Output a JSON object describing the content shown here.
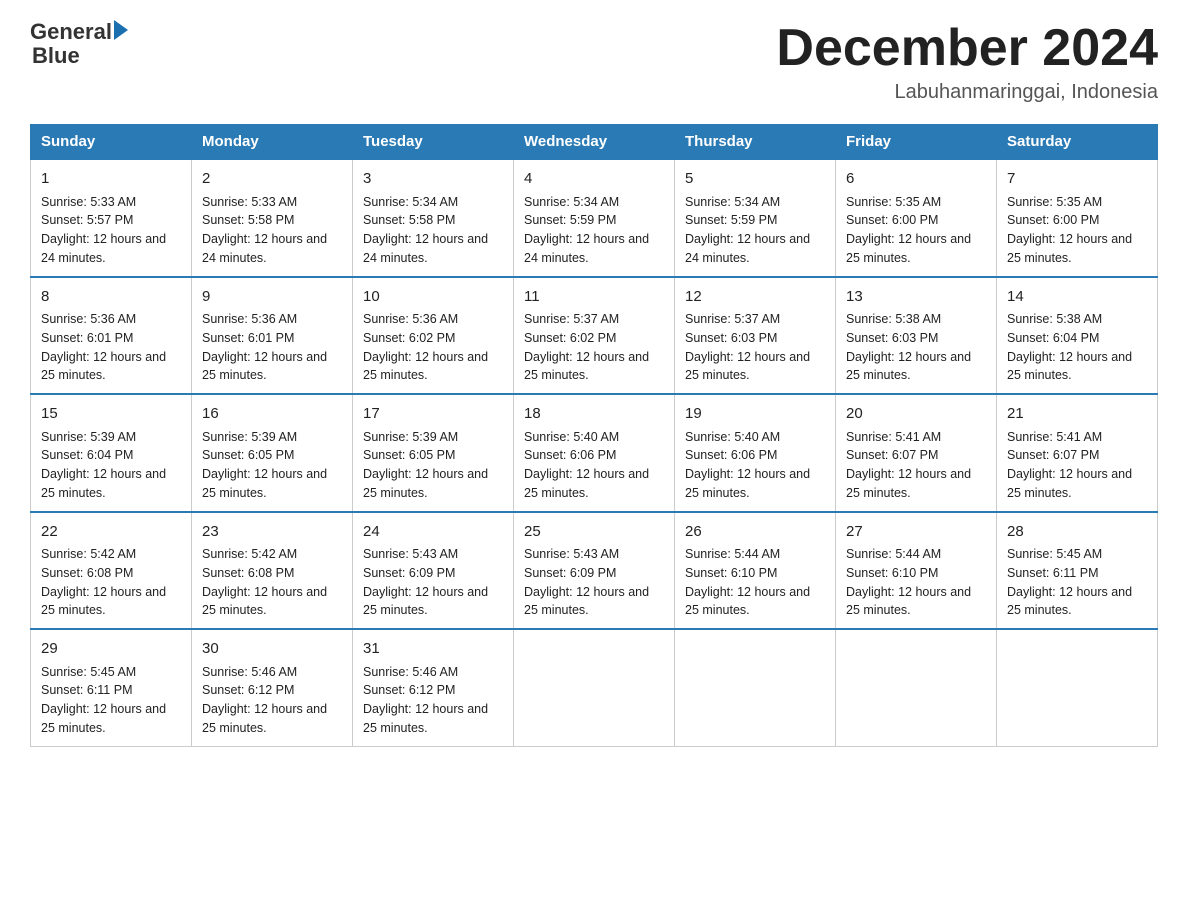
{
  "logo": {
    "line1": "General",
    "line2": "Blue"
  },
  "title": "December 2024",
  "location": "Labuhanmaringgai, Indonesia",
  "days_of_week": [
    "Sunday",
    "Monday",
    "Tuesday",
    "Wednesday",
    "Thursday",
    "Friday",
    "Saturday"
  ],
  "weeks": [
    [
      {
        "day": "1",
        "sunrise": "5:33 AM",
        "sunset": "5:57 PM",
        "daylight": "12 hours and 24 minutes."
      },
      {
        "day": "2",
        "sunrise": "5:33 AM",
        "sunset": "5:58 PM",
        "daylight": "12 hours and 24 minutes."
      },
      {
        "day": "3",
        "sunrise": "5:34 AM",
        "sunset": "5:58 PM",
        "daylight": "12 hours and 24 minutes."
      },
      {
        "day": "4",
        "sunrise": "5:34 AM",
        "sunset": "5:59 PM",
        "daylight": "12 hours and 24 minutes."
      },
      {
        "day": "5",
        "sunrise": "5:34 AM",
        "sunset": "5:59 PM",
        "daylight": "12 hours and 24 minutes."
      },
      {
        "day": "6",
        "sunrise": "5:35 AM",
        "sunset": "6:00 PM",
        "daylight": "12 hours and 25 minutes."
      },
      {
        "day": "7",
        "sunrise": "5:35 AM",
        "sunset": "6:00 PM",
        "daylight": "12 hours and 25 minutes."
      }
    ],
    [
      {
        "day": "8",
        "sunrise": "5:36 AM",
        "sunset": "6:01 PM",
        "daylight": "12 hours and 25 minutes."
      },
      {
        "day": "9",
        "sunrise": "5:36 AM",
        "sunset": "6:01 PM",
        "daylight": "12 hours and 25 minutes."
      },
      {
        "day": "10",
        "sunrise": "5:36 AM",
        "sunset": "6:02 PM",
        "daylight": "12 hours and 25 minutes."
      },
      {
        "day": "11",
        "sunrise": "5:37 AM",
        "sunset": "6:02 PM",
        "daylight": "12 hours and 25 minutes."
      },
      {
        "day": "12",
        "sunrise": "5:37 AM",
        "sunset": "6:03 PM",
        "daylight": "12 hours and 25 minutes."
      },
      {
        "day": "13",
        "sunrise": "5:38 AM",
        "sunset": "6:03 PM",
        "daylight": "12 hours and 25 minutes."
      },
      {
        "day": "14",
        "sunrise": "5:38 AM",
        "sunset": "6:04 PM",
        "daylight": "12 hours and 25 minutes."
      }
    ],
    [
      {
        "day": "15",
        "sunrise": "5:39 AM",
        "sunset": "6:04 PM",
        "daylight": "12 hours and 25 minutes."
      },
      {
        "day": "16",
        "sunrise": "5:39 AM",
        "sunset": "6:05 PM",
        "daylight": "12 hours and 25 minutes."
      },
      {
        "day": "17",
        "sunrise": "5:39 AM",
        "sunset": "6:05 PM",
        "daylight": "12 hours and 25 minutes."
      },
      {
        "day": "18",
        "sunrise": "5:40 AM",
        "sunset": "6:06 PM",
        "daylight": "12 hours and 25 minutes."
      },
      {
        "day": "19",
        "sunrise": "5:40 AM",
        "sunset": "6:06 PM",
        "daylight": "12 hours and 25 minutes."
      },
      {
        "day": "20",
        "sunrise": "5:41 AM",
        "sunset": "6:07 PM",
        "daylight": "12 hours and 25 minutes."
      },
      {
        "day": "21",
        "sunrise": "5:41 AM",
        "sunset": "6:07 PM",
        "daylight": "12 hours and 25 minutes."
      }
    ],
    [
      {
        "day": "22",
        "sunrise": "5:42 AM",
        "sunset": "6:08 PM",
        "daylight": "12 hours and 25 minutes."
      },
      {
        "day": "23",
        "sunrise": "5:42 AM",
        "sunset": "6:08 PM",
        "daylight": "12 hours and 25 minutes."
      },
      {
        "day": "24",
        "sunrise": "5:43 AM",
        "sunset": "6:09 PM",
        "daylight": "12 hours and 25 minutes."
      },
      {
        "day": "25",
        "sunrise": "5:43 AM",
        "sunset": "6:09 PM",
        "daylight": "12 hours and 25 minutes."
      },
      {
        "day": "26",
        "sunrise": "5:44 AM",
        "sunset": "6:10 PM",
        "daylight": "12 hours and 25 minutes."
      },
      {
        "day": "27",
        "sunrise": "5:44 AM",
        "sunset": "6:10 PM",
        "daylight": "12 hours and 25 minutes."
      },
      {
        "day": "28",
        "sunrise": "5:45 AM",
        "sunset": "6:11 PM",
        "daylight": "12 hours and 25 minutes."
      }
    ],
    [
      {
        "day": "29",
        "sunrise": "5:45 AM",
        "sunset": "6:11 PM",
        "daylight": "12 hours and 25 minutes."
      },
      {
        "day": "30",
        "sunrise": "5:46 AM",
        "sunset": "6:12 PM",
        "daylight": "12 hours and 25 minutes."
      },
      {
        "day": "31",
        "sunrise": "5:46 AM",
        "sunset": "6:12 PM",
        "daylight": "12 hours and 25 minutes."
      },
      null,
      null,
      null,
      null
    ]
  ]
}
